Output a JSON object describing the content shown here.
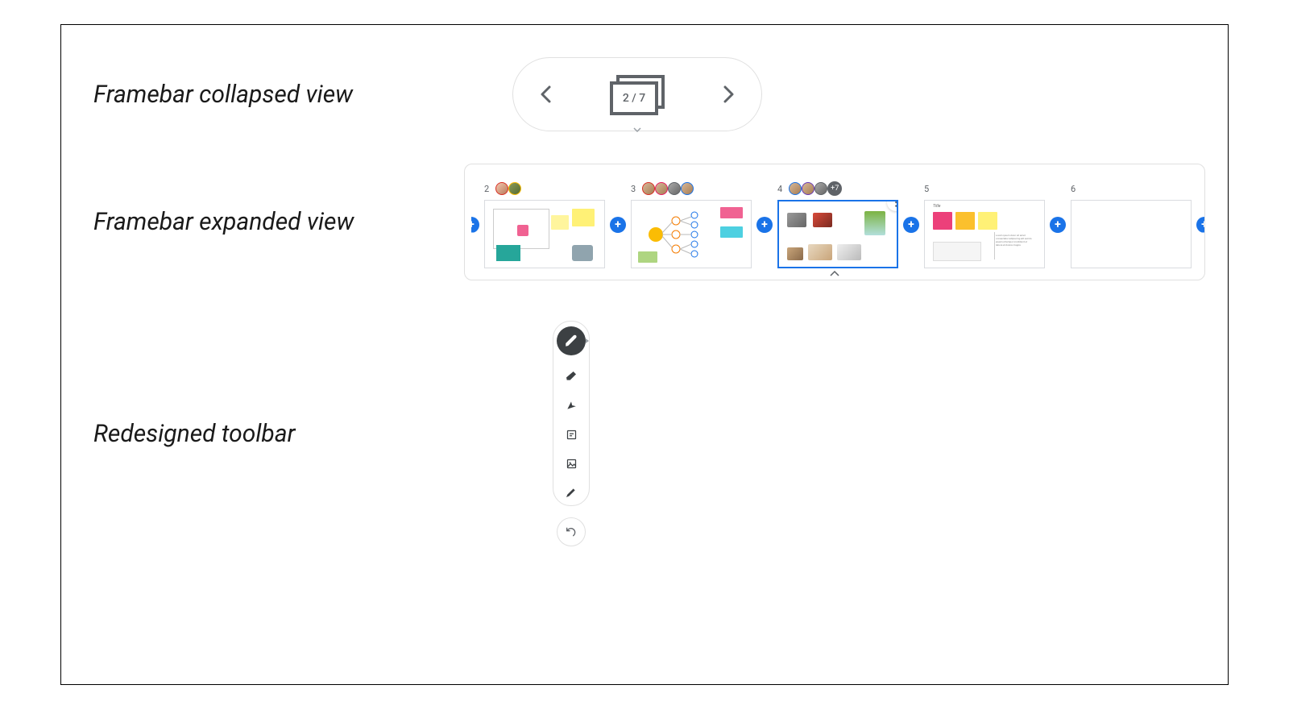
{
  "labels": {
    "collapsed": "Framebar collapsed view",
    "expanded": "Framebar expanded view",
    "toolbar": "Redesigned toolbar"
  },
  "collapsed": {
    "counter": "2 / 7"
  },
  "expanded": {
    "slides": [
      {
        "num": "2",
        "avatars": [
          {
            "border": "#d93025"
          },
          {
            "border": "#fbbc04"
          }
        ],
        "selected": false
      },
      {
        "num": "3",
        "avatars": [
          {
            "border": "#d93025"
          },
          {
            "border": "#e91e63"
          },
          {
            "border": "#5f6368"
          },
          {
            "border": "#1a73e8"
          }
        ],
        "selected": false
      },
      {
        "num": "4",
        "avatars": [
          {
            "border": "#1a73e8"
          },
          {
            "border": "#673ab7"
          },
          {
            "border": "#5f6368"
          }
        ],
        "more": "+7",
        "selected": true
      },
      {
        "num": "5",
        "avatars": [],
        "selected": false
      },
      {
        "num": "6",
        "avatars": [],
        "selected": false
      }
    ]
  },
  "toolbar": {
    "tools": [
      "pen",
      "eraser",
      "pointer",
      "note",
      "image",
      "laser"
    ],
    "active": "pen"
  }
}
